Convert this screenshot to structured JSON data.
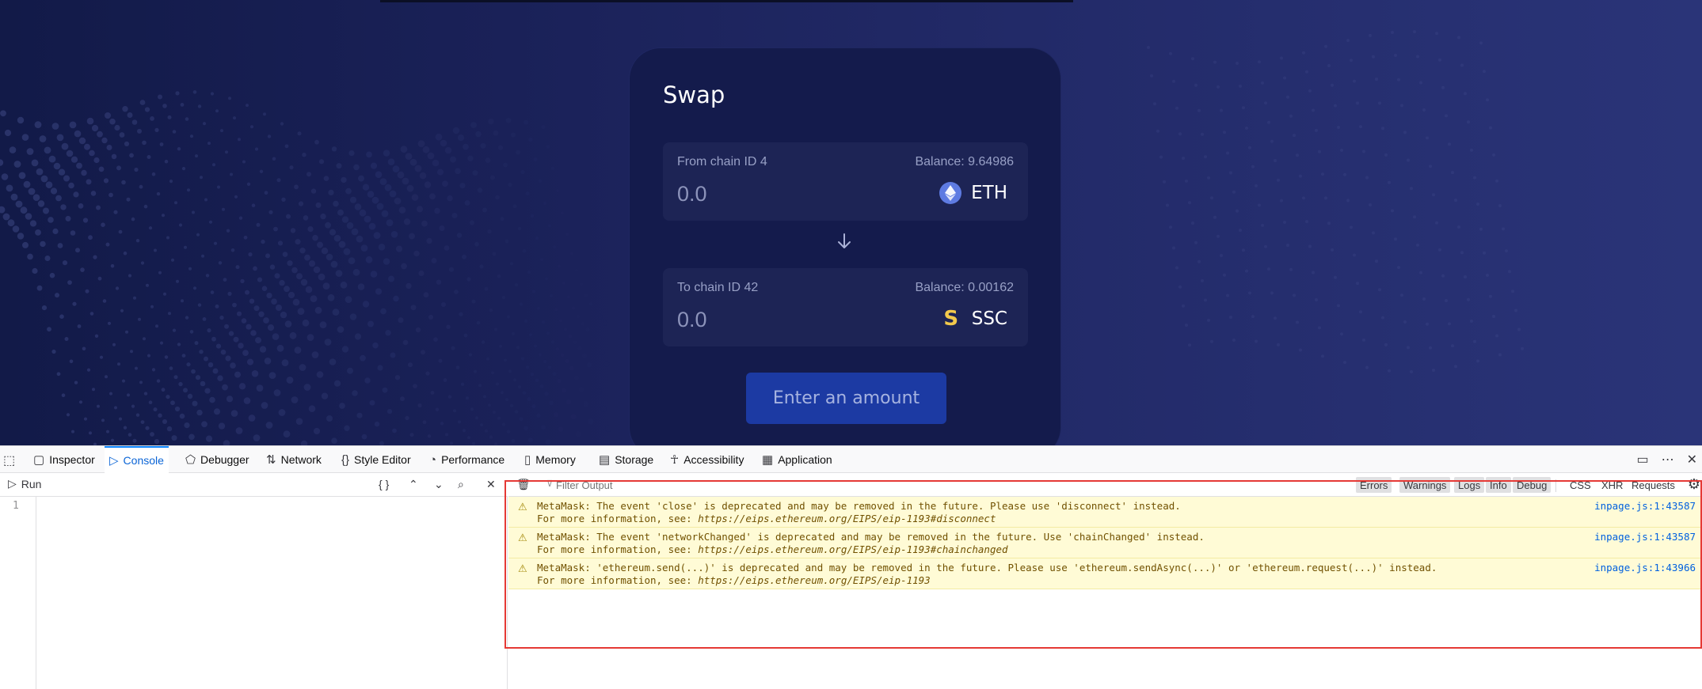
{
  "swap": {
    "title": "Swap",
    "from": {
      "label": "From chain ID 4",
      "balance": "Balance: 9.64986",
      "amount_placeholder": "0.0",
      "token": "ETH"
    },
    "to": {
      "label": "To chain ID 42",
      "balance": "Balance: 0.00162",
      "amount_placeholder": "0.0",
      "token": "SSC"
    },
    "action_label": "Enter an amount"
  },
  "devtools": {
    "tabs": [
      {
        "label": "Inspector",
        "icon": "inspector-icon"
      },
      {
        "label": "Console",
        "icon": "console-icon",
        "active": true
      },
      {
        "label": "Debugger",
        "icon": "debugger-icon"
      },
      {
        "label": "Network",
        "icon": "network-icon"
      },
      {
        "label": "Style Editor",
        "icon": "style-editor-icon"
      },
      {
        "label": "Performance",
        "icon": "performance-icon"
      },
      {
        "label": "Memory",
        "icon": "memory-icon"
      },
      {
        "label": "Storage",
        "icon": "storage-icon"
      },
      {
        "label": "Accessibility",
        "icon": "accessibility-icon"
      },
      {
        "label": "Application",
        "icon": "application-icon"
      }
    ],
    "editor": {
      "run_label": "Run",
      "pretty_label": "{ }",
      "line_number": "1"
    },
    "filter": {
      "placeholder": "Filter Output",
      "levels": [
        "Errors",
        "Warnings",
        "Logs",
        "Info",
        "Debug"
      ],
      "types": [
        "CSS",
        "XHR",
        "Requests"
      ]
    },
    "messages": [
      {
        "line1": "MetaMask: The event 'close' is deprecated and may be removed in the future. Please use 'disconnect' instead.",
        "line2_prefix": "For more information, see: ",
        "url": "https://eips.ethereum.org/EIPS/eip-1193#disconnect",
        "source": "inpage.js:1:43587"
      },
      {
        "line1": "MetaMask: The event 'networkChanged' is deprecated and may be removed in the future. Use 'chainChanged' instead.",
        "line2_prefix": "For more information, see: ",
        "url": "https://eips.ethereum.org/EIPS/eip-1193#chainchanged",
        "source": "inpage.js:1:43587"
      },
      {
        "line1": "MetaMask: 'ethereum.send(...)' is deprecated and may be removed in the future. Please use 'ethereum.sendAsync(...)' or 'ethereum.request(...)' instead.",
        "line2_prefix": "For more information, see: ",
        "url": "https://eips.ethereum.org/EIPS/eip-1193",
        "source": "inpage.js:1:43966"
      }
    ]
  },
  "colors": {
    "accent": "#0a84ff",
    "highlight": "#e53935",
    "warning_bg": "#fffbd6",
    "button": "#1c3aa3"
  }
}
